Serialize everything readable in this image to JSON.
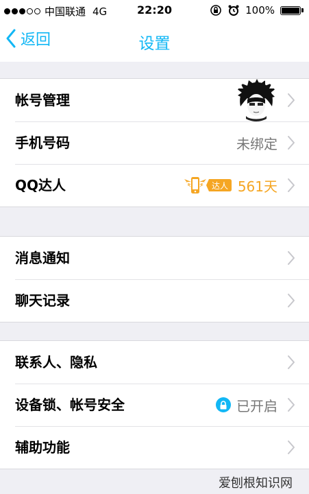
{
  "status_bar": {
    "carrier": "中国联通",
    "network": "4G",
    "time": "22:20",
    "battery": "100%",
    "signal_strength": "3 of 5"
  },
  "nav": {
    "back_label": "返回",
    "title": "设置"
  },
  "groups": [
    {
      "rows": [
        {
          "label": "帐号管理"
        },
        {
          "label": "手机号码",
          "value": "未绑定"
        },
        {
          "label": "QQ达人",
          "badge": "达人",
          "value": "561天"
        }
      ]
    },
    {
      "rows": [
        {
          "label": "消息通知"
        },
        {
          "label": "聊天记录"
        }
      ]
    },
    {
      "rows": [
        {
          "label": "联系人、隐私"
        },
        {
          "label": "设备锁、帐号安全",
          "value": "已开启"
        },
        {
          "label": "辅助功能"
        }
      ]
    }
  ],
  "watermark": "爱刨根知识网",
  "colors": {
    "accent": "#12b7f5",
    "orange": "#f5a623",
    "background": "#efeff4"
  }
}
